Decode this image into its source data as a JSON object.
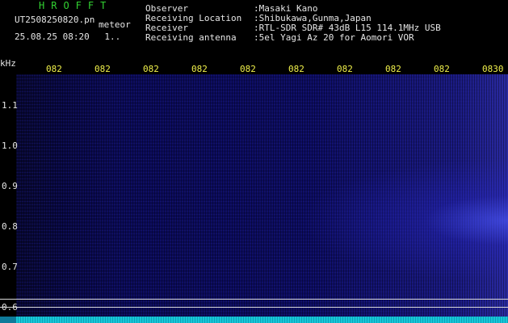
{
  "header": {
    "brand": "HROFFT",
    "filename": "UT2508250820.pn",
    "mode": "meteor",
    "datetime": "25.08.25 08:20",
    "counter": "1.."
  },
  "station_info": [
    {
      "label": "Observer",
      "value": ":Masaki Kano"
    },
    {
      "label": "Receiving Location",
      "value": ":Shibukawa,Gunma,Japan"
    },
    {
      "label": "Receiver",
      "value": ":RTL-SDR SDR# 43dB L15 114.1MHz USB"
    },
    {
      "label": "Receiving antenna",
      "value": ":5el Yagi Az 20 for Aomori VOR"
    }
  ],
  "axes": {
    "y_unit": "kHz",
    "x_ticks": [
      "082",
      "082",
      "082",
      "082",
      "082",
      "082",
      "082",
      "082",
      "082",
      "0830"
    ],
    "y_ticks": [
      "1.1",
      "1.0",
      "0.9",
      "0.8",
      "0.7",
      "0.6"
    ]
  },
  "colors": {
    "spectrogram_bg": "#0b0b52",
    "label_green": "#32d232",
    "text_white": "#e6e6e6",
    "tick_yellow": "#f0f04a",
    "signal_strip": "#16c8d8"
  }
}
